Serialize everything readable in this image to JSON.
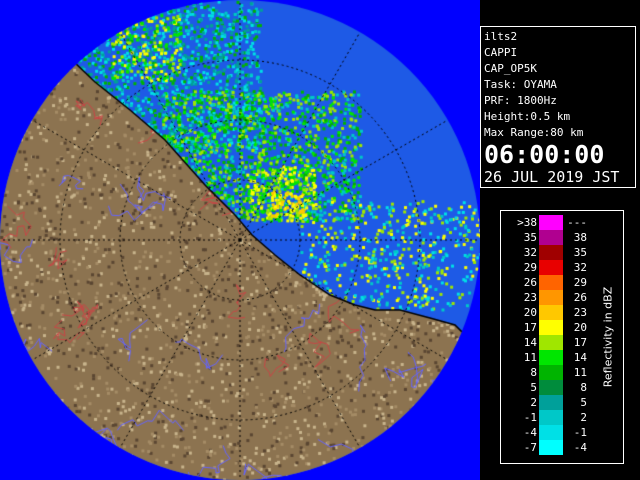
{
  "info": {
    "radar_name": "ilts2",
    "product": "CAPPI",
    "product_code": "CAP_OP5K",
    "task": "Task: OYAMA",
    "prf": "PRF: 1800Hz",
    "height": "Height:0.5 km",
    "max_range": "Max Range:80 km",
    "time": "06:00:00",
    "date": "26 JUL 2019 JST"
  },
  "legend": {
    "title": "Reflectivity in dBZ",
    "rows": [
      {
        "low": ">38",
        "high": "---",
        "color": "#ff00ff"
      },
      {
        "low": "35",
        "high": "38",
        "color": "#b00090"
      },
      {
        "low": "32",
        "high": "35",
        "color": "#a00000"
      },
      {
        "low": "29",
        "high": "32",
        "color": "#e80000"
      },
      {
        "low": "26",
        "high": "29",
        "color": "#ff6400"
      },
      {
        "low": "23",
        "high": "26",
        "color": "#ff9600"
      },
      {
        "low": "20",
        "high": "23",
        "color": "#ffc800"
      },
      {
        "low": "17",
        "high": "20",
        "color": "#ffff00"
      },
      {
        "low": "14",
        "high": "17",
        "color": "#a0e600"
      },
      {
        "low": "11",
        "high": "14",
        "color": "#00e600"
      },
      {
        "low": "8",
        "high": "11",
        "color": "#00b400"
      },
      {
        "low": "5",
        "high": "8",
        "color": "#008c3c"
      },
      {
        "low": "2",
        "high": "5",
        "color": "#00a09a"
      },
      {
        "low": "-1",
        "high": "2",
        "color": "#00c8c8"
      },
      {
        "low": "-4",
        "high": "-1",
        "color": "#00e0e6"
      },
      {
        "low": "-7",
        "high": "-4",
        "color": "#00ffff"
      }
    ]
  },
  "map": {
    "range_background_color": "#1e5ae6",
    "outside_range_color": "#0000ff",
    "land_color": "#8c7350",
    "coastline_color": "#000000",
    "river_color": "#6464ff",
    "boundary_color": "#c84646"
  }
}
